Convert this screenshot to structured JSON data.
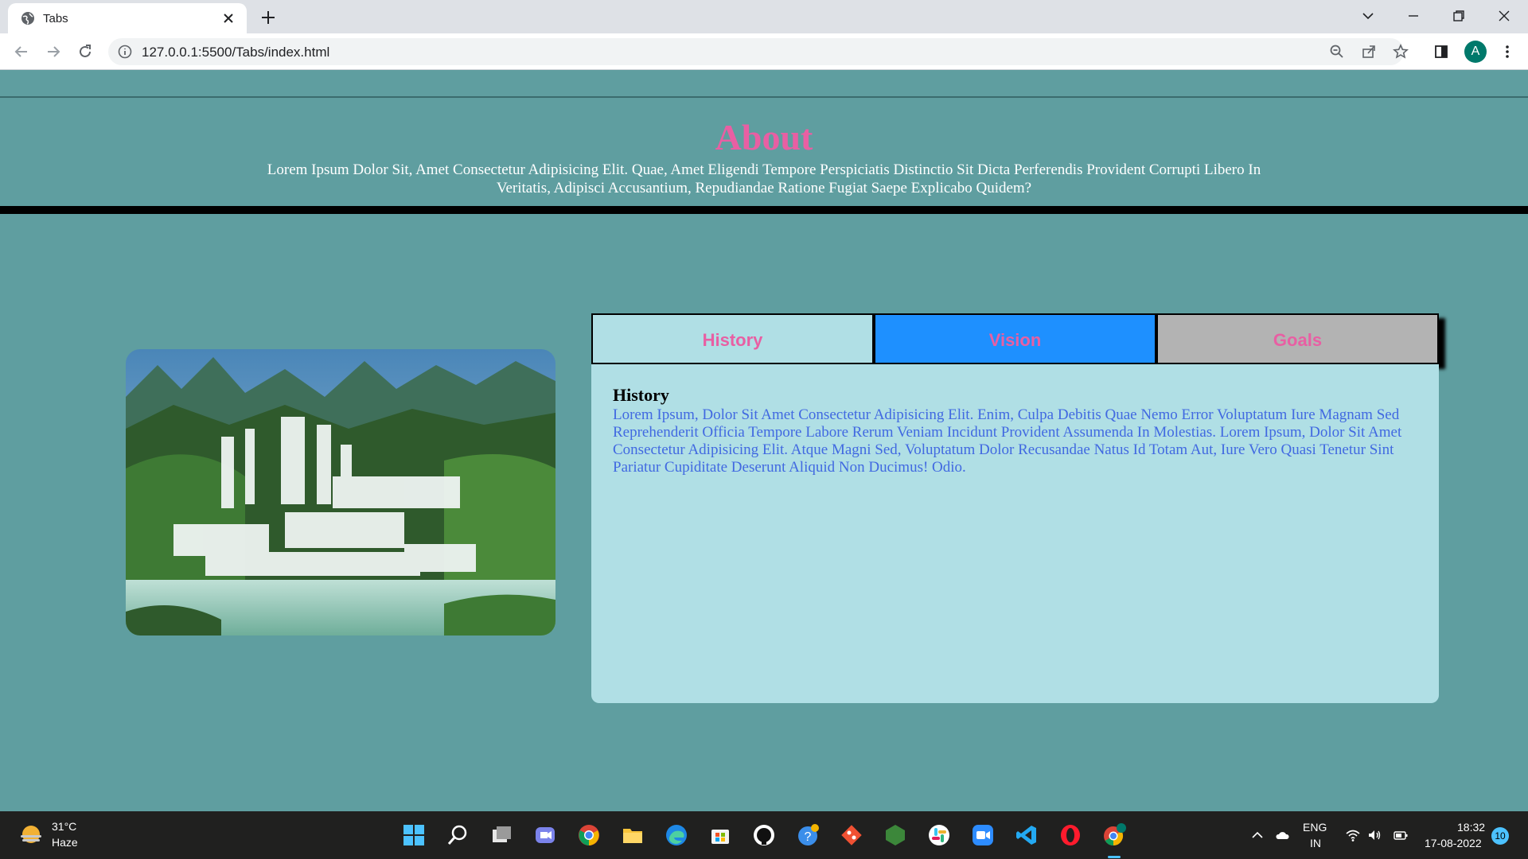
{
  "browser": {
    "tab_title": "Tabs",
    "url": "127.0.0.1:5500/Tabs/index.html",
    "profile_initial": "A"
  },
  "about": {
    "title": "About",
    "text": "Lorem Ipsum Dolor Sit, Amet Consectetur Adipisicing Elit. Quae, Amet Eligendi Tempore Perspiciatis Distinctio Sit Dicta Perferendis Provident Corrupti Libero In Veritatis, Adipisci Accusantium, Repudiandae Ratione Fugiat Saepe Explicabo Quidem?"
  },
  "tabs": [
    {
      "label": "History",
      "bg": "#b0dfe5"
    },
    {
      "label": "Vision",
      "bg": "#1e90ff"
    },
    {
      "label": "Goals",
      "bg": "#b3b3b3"
    }
  ],
  "panel": {
    "title": "History",
    "text": "Lorem Ipsum, Dolor Sit Amet Consectetur Adipisicing Elit. Enim, Culpa Debitis Quae Nemo Error Voluptatum Iure Magnam Sed Reprehenderit Officia Tempore Labore Rerum Veniam Incidunt Provident Assumenda In Molestias. Lorem Ipsum, Dolor Sit Amet Consectetur Adipisicing Elit. Atque Magni Sed, Voluptatum Dolor Recusandae Natus Id Totam Aut, Iure Vero Quasi Tenetur Sint Pariatur Cupiditate Deserunt Aliquid Non Ducimus! Odio."
  },
  "colors": {
    "page_bg": "#5f9ea0",
    "accent_pink": "#e85fa3",
    "link_blue": "#4169e1"
  },
  "taskbar": {
    "temperature": "31°C",
    "condition": "Haze",
    "lang_line1": "ENG",
    "lang_line2": "IN",
    "time": "18:32",
    "date": "17-08-2022",
    "notification_count": "10",
    "apps": [
      "start-icon",
      "search-icon",
      "task-view-icon",
      "teams-chat-icon",
      "chrome-icon",
      "file-explorer-icon",
      "edge-icon",
      "microsoft-store-icon",
      "github-icon",
      "help-icon",
      "git-icon",
      "nodejs-icon",
      "slack-icon",
      "zoom-icon",
      "vscode-icon",
      "opera-icon",
      "chrome-profile-icon"
    ]
  }
}
